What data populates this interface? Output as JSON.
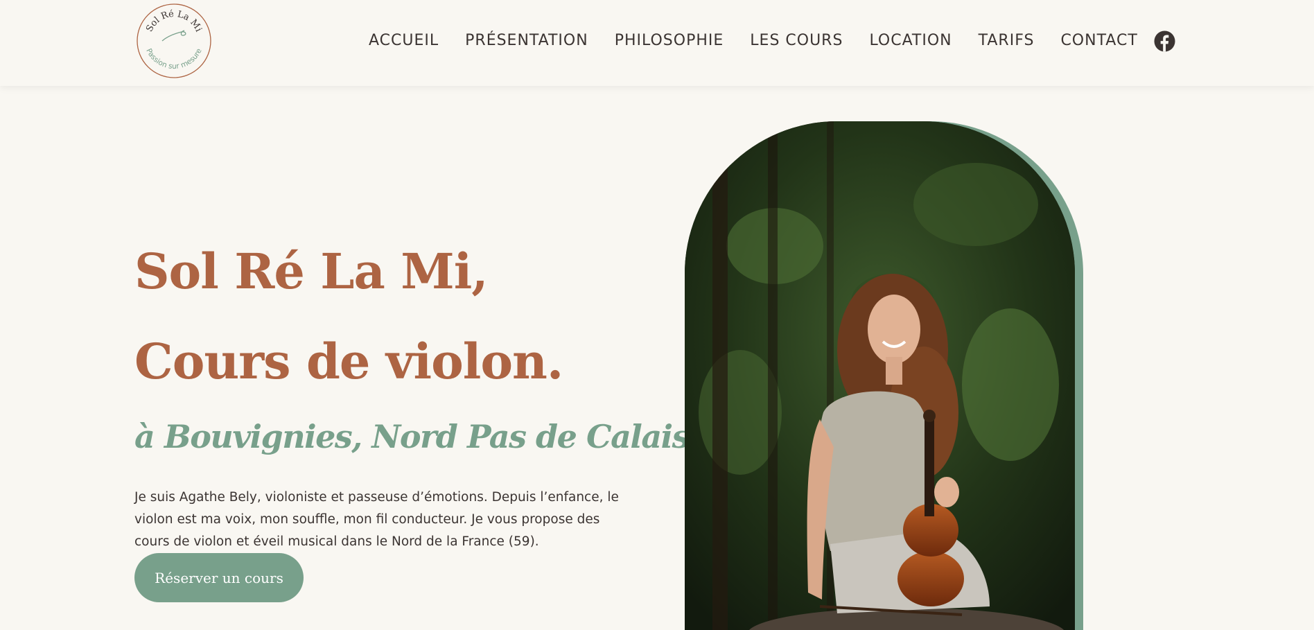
{
  "logo": {
    "name_text": "Sol Ré La Mi",
    "tagline_text": "Passion sur mesure"
  },
  "nav": {
    "items": [
      "ACCUEIL",
      "PRÉSENTATION",
      "PHILOSOPHIE",
      "LES COURS",
      "LOCATION",
      "TARIFS",
      "CONTACT"
    ],
    "social_icon": "facebook-icon"
  },
  "hero": {
    "title_line1": "Sol Ré La Mi,",
    "title_line2": "Cours de violon.",
    "subtitle": "à Bouvignies, Nord Pas de Calais",
    "intro": "Je suis Agathe Bely, violoniste et passeuse d’émotions. Depuis l’enfance, le violon est ma voix, mon souffle, mon fil conducteur. Je vous propose des cours de violon et éveil musical dans le Nord de la France (59).",
    "cta_label": "Réserver un cours"
  },
  "colors": {
    "background": "#f9f7f2",
    "title": "#ad6443",
    "accent_green": "#78a08b",
    "text": "#3b3432"
  }
}
